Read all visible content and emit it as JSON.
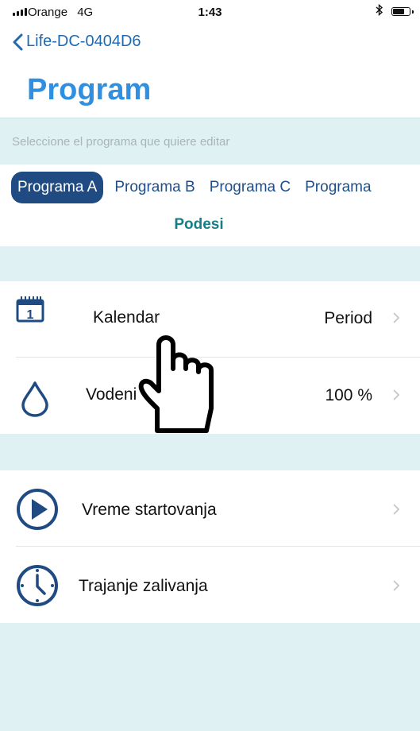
{
  "status_bar": {
    "carrier": "Orange",
    "network": "4G",
    "time": "1:43"
  },
  "nav": {
    "back_label": "Life-DC-0404D6"
  },
  "page": {
    "title": "Program",
    "hint": "Seleccione el programa que quiere editar",
    "section_label": "Podesi"
  },
  "tabs": [
    {
      "label": "Programa A",
      "selected": true
    },
    {
      "label": "Programa B"
    },
    {
      "label": "Programa C"
    },
    {
      "label": "Programa"
    }
  ],
  "settings": {
    "calendar": {
      "label": "Kalendar",
      "value": "Period",
      "icon": "calendar-icon"
    },
    "water": {
      "label": "Vodeni",
      "value": "100 %",
      "icon": "water-drop-icon"
    },
    "start_time": {
      "label": "Vreme startovanja",
      "icon": "play-icon"
    },
    "duration": {
      "label": "Trajanje zalivanja",
      "icon": "clock-icon"
    }
  },
  "overlay": {
    "icon": "pointing-hand-icon"
  },
  "colors": {
    "accent": "#2f8fe0",
    "tab_selected_bg": "#1f4b82",
    "band_bg": "#dff1f2",
    "section_text": "#167f86",
    "icon_blue": "#1f4b82"
  }
}
